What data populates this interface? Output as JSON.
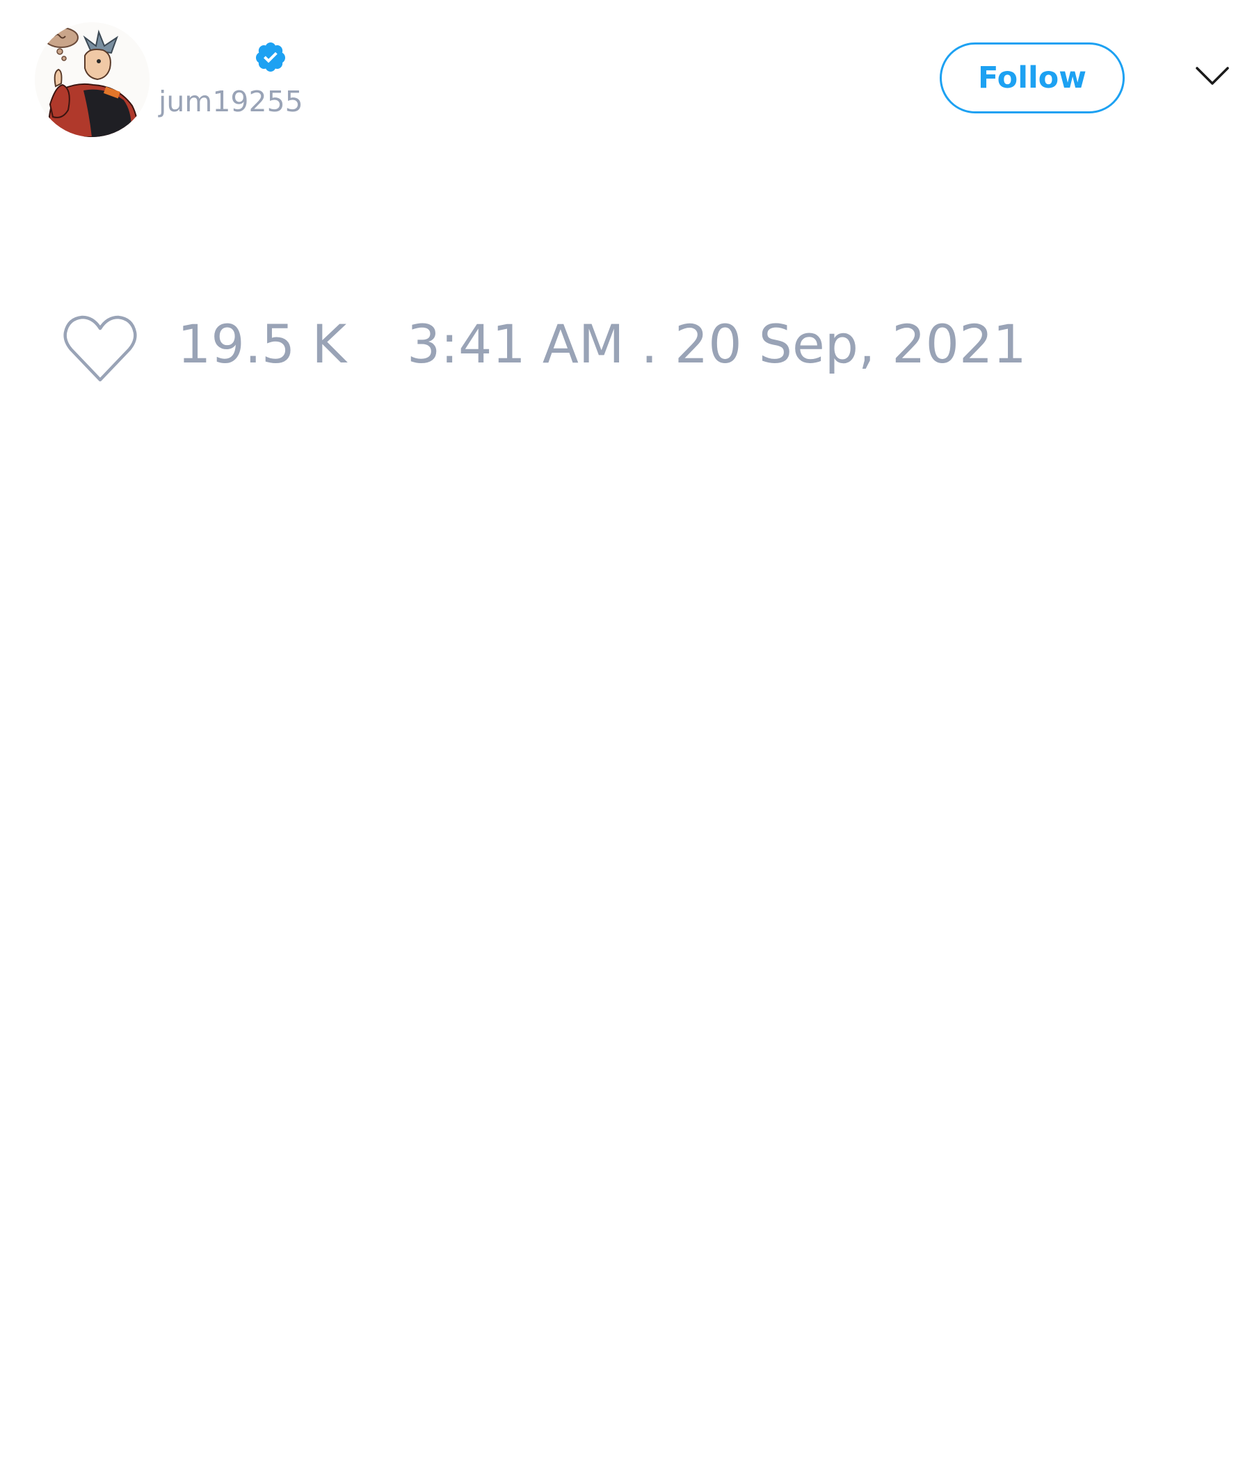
{
  "tweet": {
    "author": {
      "handle": "jum19255",
      "verified": true,
      "avatar_icon": "cartoon-avatar-icon"
    },
    "follow_label": "Follow",
    "menu_icon": "chevron-down-icon",
    "like_icon": "heart-outline-icon",
    "like_count": "19.5 K",
    "timestamp": "3:41 AM . 20 Sep, 2021"
  },
  "colors": {
    "accent": "#1da1f2",
    "muted_text": "#99a3b6",
    "background": "#ffffff"
  }
}
